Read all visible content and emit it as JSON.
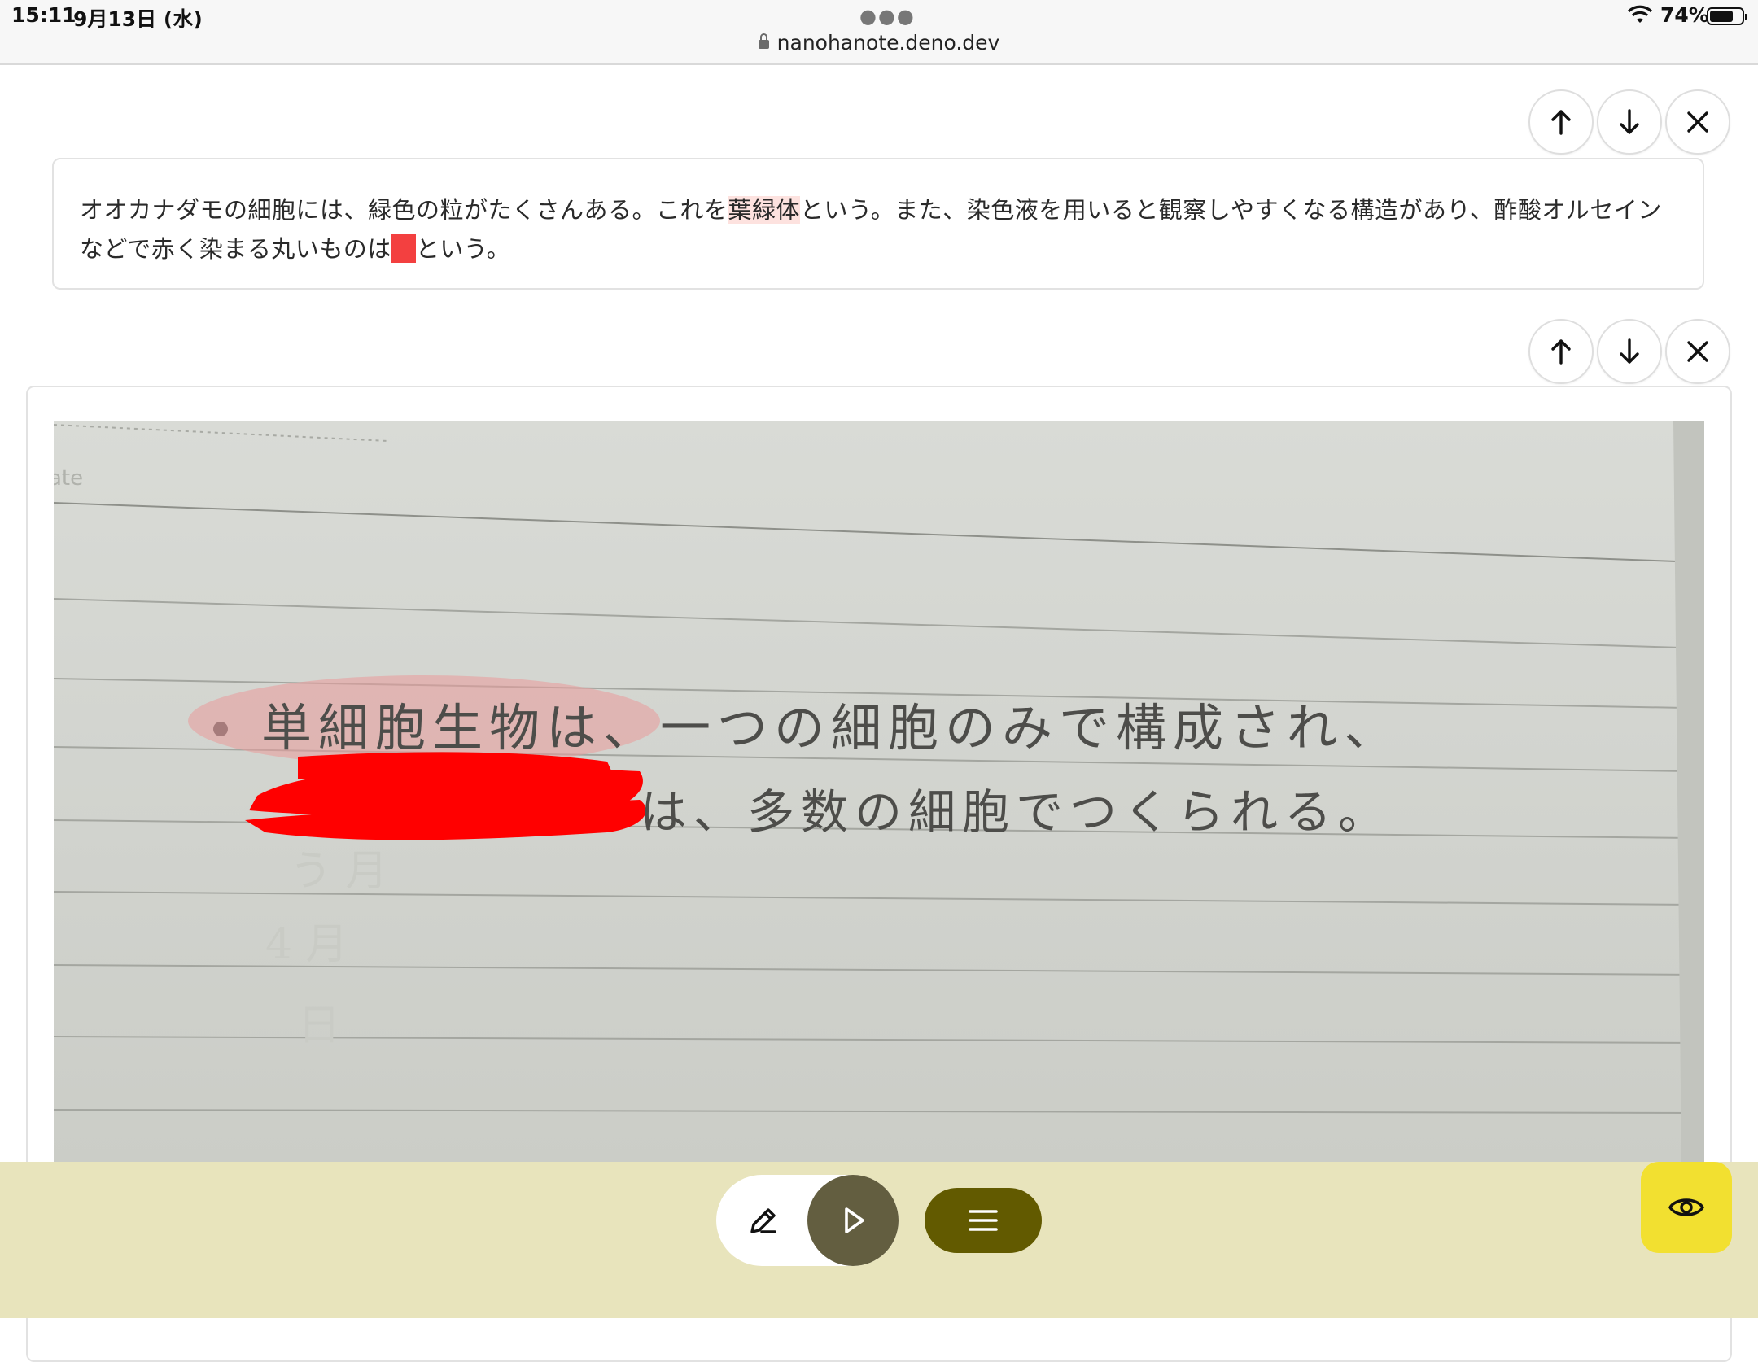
{
  "status_bar": {
    "time": "15:11",
    "date": "9月13日 (水)",
    "battery": "74%",
    "battery_level": 0.74,
    "url": "nanohanote.deno.dev"
  },
  "cards": {
    "text_card": {
      "segments": {
        "part1": "オオカナダモの細胞には、緑色の粒がたくさんある。これを",
        "highlight": "葉緑体",
        "part2": "という。また、染色液を用いると観察しやすくなる構造があり、酢酸オルセインなどで赤く染まる丸いものは",
        "part3": "という。"
      }
    },
    "image_card": {
      "handwriting_line1": "単細胞生物は、一つの細胞のみで構成され、",
      "handwriting_line2": "は、多数の細胞でつくられる。",
      "highlight_word": "単細胞生物",
      "margin_text": "ate"
    }
  },
  "controls": {
    "move_up_icon": "arrow-up-icon",
    "move_down_icon": "arrow-down-icon",
    "delete_icon": "close-icon"
  },
  "toolbar": {
    "edit_icon": "pencil-icon",
    "play_icon": "play-icon",
    "menu_icon": "hamburger-icon",
    "view_icon": "eye-icon"
  },
  "colors": {
    "toolbar_bg": "#e8e4bc",
    "play_bg": "#635e40",
    "menu_bg": "#625a00",
    "eye_bg": "#f2e030",
    "blank_red": "#f34040",
    "highlight_pink": "#fde2df"
  }
}
